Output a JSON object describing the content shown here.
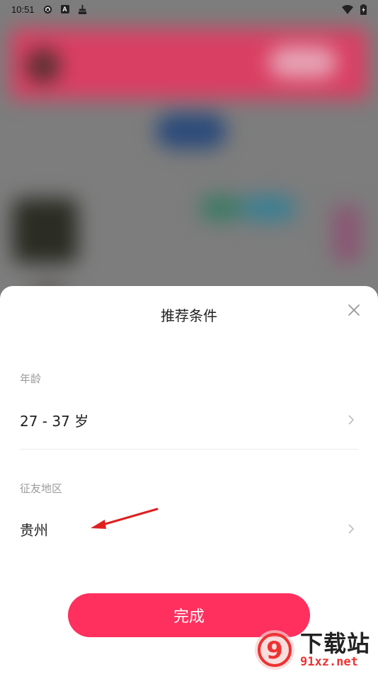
{
  "status_bar": {
    "time": "10:51",
    "icons_left": [
      "sync-icon",
      "a-badge-icon",
      "broom-icon"
    ],
    "icons_right": [
      "wifi-icon",
      "battery-icon"
    ]
  },
  "sheet": {
    "title": "推荐条件",
    "age": {
      "label": "年龄",
      "value": "27 - 37 岁"
    },
    "region": {
      "label": "征友地区",
      "value": "贵州"
    },
    "done_label": "完成"
  },
  "watermark": {
    "brand": "下载站",
    "domain": "91xz.net",
    "logo_text": "9"
  },
  "colors": {
    "accent": "#ff2f5e",
    "annotation_arrow": "#e02020"
  }
}
